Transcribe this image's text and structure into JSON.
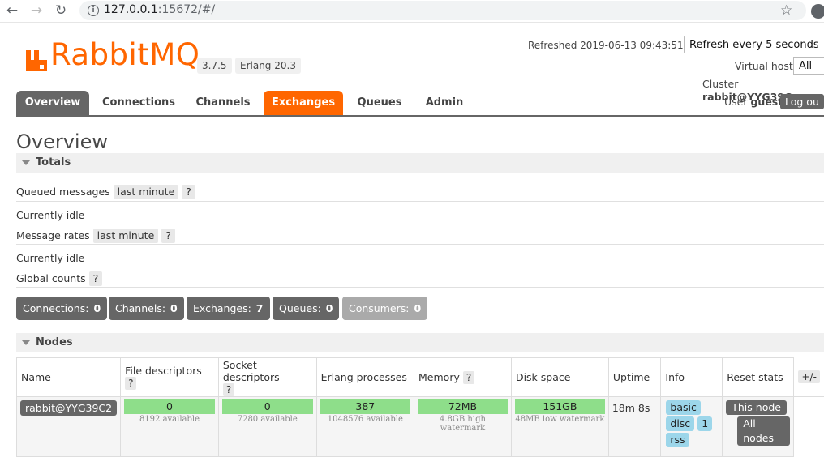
{
  "browser": {
    "url_host": "127.0.0.1",
    "url_rest": ":15672/#/"
  },
  "header": {
    "logo_text": "RabbitMQ",
    "version": "3.7.5",
    "erlang": "Erlang 20.3",
    "refreshed": "Refreshed 2019-06-13 09:43:51",
    "refresh_option": "Refresh every 5 seconds",
    "virtual_host_label": "Virtual host",
    "virtual_host_value": "All",
    "cluster_label": "Cluster",
    "cluster_value": "rabbit@YYG39C",
    "user_label": "User",
    "user_value": "guest",
    "logout": "Log ou"
  },
  "tabs": [
    "Overview",
    "Connections",
    "Channels",
    "Exchanges",
    "Queues",
    "Admin"
  ],
  "page_title": "Overview",
  "totals": {
    "section": "Totals",
    "queued_label": "Queued messages",
    "queued_range": "last minute",
    "help": "?",
    "idle1": "Currently idle",
    "rates_label": "Message rates",
    "rates_range": "last minute",
    "idle2": "Currently idle",
    "global_label": "Global counts"
  },
  "counts": [
    {
      "label": "Connections:",
      "value": "0"
    },
    {
      "label": "Channels:",
      "value": "0"
    },
    {
      "label": "Exchanges:",
      "value": "7"
    },
    {
      "label": "Queues:",
      "value": "0"
    },
    {
      "label": "Consumers:",
      "value": "0"
    }
  ],
  "nodes": {
    "section": "Nodes",
    "headers": [
      "Name",
      "File descriptors",
      "Socket descriptors",
      "Erlang processes",
      "Memory",
      "Disk space",
      "Uptime",
      "Info",
      "Reset stats",
      "+/-"
    ],
    "row": {
      "name": "rabbit@YYG39C2",
      "fd": "0",
      "fd_sub": "8192 available",
      "sd": "0",
      "sd_sub": "7280 available",
      "ep": "387",
      "ep_sub": "1048576 available",
      "mem": "72MB",
      "mem_sub": "4.8GB high watermark",
      "disk": "151GB",
      "disk_sub": "48MB low watermark",
      "uptime": "18m 8s",
      "info": [
        "basic",
        "disc",
        "1",
        "rss"
      ],
      "reset_this": "This node",
      "reset_all": "All nodes"
    }
  },
  "colors": {
    "brand": "#ff6600",
    "tab_dark": "#666666",
    "bar_green": "#8ede8a",
    "info_blue": "#9cd6ea"
  }
}
